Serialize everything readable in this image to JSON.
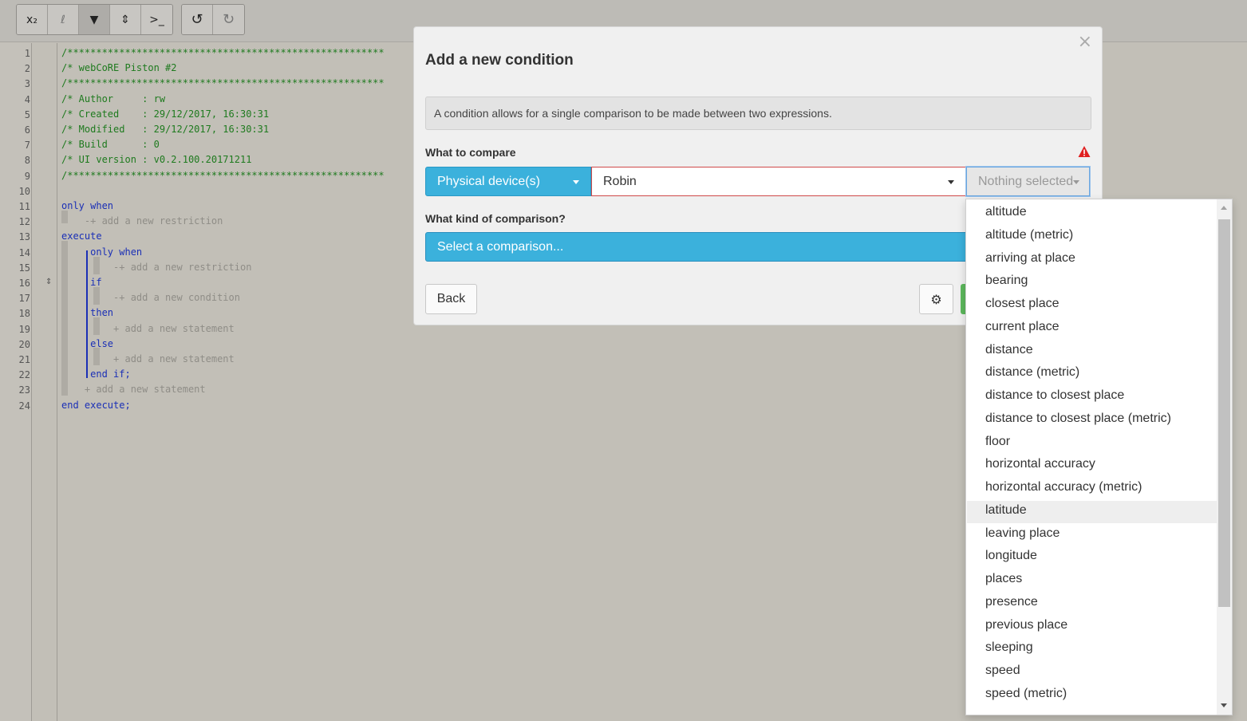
{
  "toolbar": {
    "buttons": [
      {
        "name": "subscript-button",
        "glyph": "x₂"
      },
      {
        "name": "variable-button",
        "glyph": "ℓ"
      },
      {
        "name": "filter-button",
        "glyph": "▼"
      },
      {
        "name": "sort-button",
        "glyph": "⇕"
      },
      {
        "name": "console-button",
        "glyph": ">_"
      }
    ],
    "undo_glyph": "↺",
    "redo_glyph": "↻"
  },
  "editor": {
    "line_numbers": [
      "1",
      "2",
      "3",
      "4",
      "5",
      "6",
      "7",
      "8",
      "9",
      "10",
      "11",
      "12",
      "13",
      "14",
      "15",
      "16",
      "17",
      "18",
      "19",
      "20",
      "21",
      "22",
      "23",
      "24"
    ],
    "lines": [
      "/*******************************************************",
      "/* webCoRE Piston #2",
      "/*******************************************************",
      "/* Author     : rw",
      "/* Created    : 29/12/2017, 16:30:31",
      "/* Modified   : 29/12/2017, 16:30:31",
      "/* Build      : 0",
      "/* UI version : v0.2.100.20171211",
      "/*******************************************************",
      "",
      "only when",
      "    -+ add a new restriction",
      "execute",
      "     only when",
      "         -+ add a new restriction",
      "     if",
      "         -+ add a new condition",
      "     then",
      "         + add a new statement",
      "     else",
      "         + add a new statement",
      "     end if;",
      "    + add a new statement",
      "end execute;"
    ]
  },
  "modal": {
    "title": "Add a new condition",
    "close_glyph": "×",
    "info": "A condition allows for a single comparison to be made between two expressions.",
    "what_to_compare_label": "What to compare",
    "subject_type": "Physical device(s)",
    "device": "Robin",
    "attribute_placeholder": "Nothing selected",
    "comparison_label": "What kind of comparison?",
    "comparison_placeholder": "Select a comparison...",
    "back_label": "Back",
    "settings_glyph": "⚙"
  },
  "attribute_options": [
    "altitude",
    "altitude (metric)",
    "arriving at place",
    "bearing",
    "closest place",
    "current place",
    "distance",
    "distance (metric)",
    "distance to closest place",
    "distance to closest place (metric)",
    "floor",
    "horizontal accuracy",
    "horizontal accuracy (metric)",
    "latitude",
    "leaving place",
    "longitude",
    "places",
    "presence",
    "previous place",
    "sleeping",
    "speed",
    "speed (metric)"
  ],
  "highlighted_option": "latitude",
  "colors": {
    "primary": "#3bb1dc",
    "success": "#5cb85c",
    "warning": "#e02020",
    "code_comment": "#1e7a1e",
    "code_keyword": "#1a2fb6"
  }
}
